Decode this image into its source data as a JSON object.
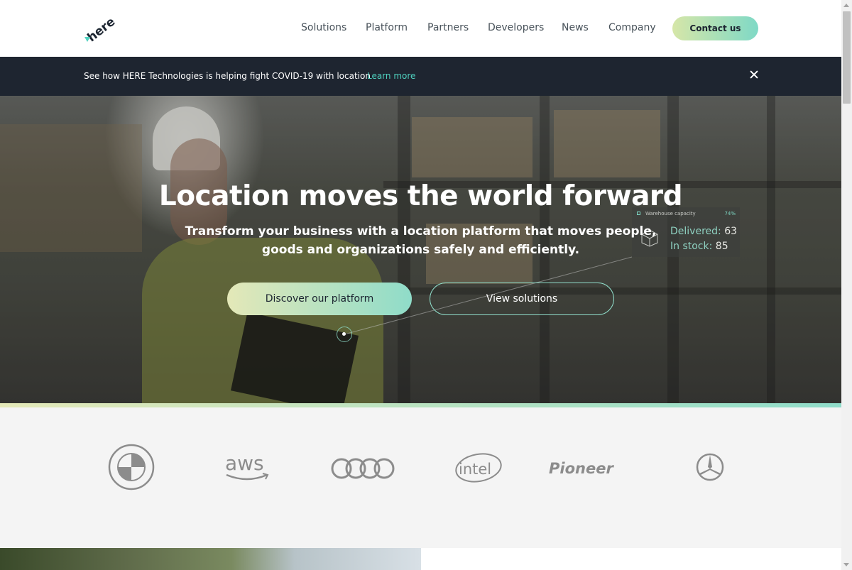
{
  "header": {
    "logo_text": "here",
    "nav": [
      "Solutions",
      "Platform",
      "Partners",
      "Developers",
      "News",
      "Company"
    ],
    "contact_label": "Contact us"
  },
  "banner": {
    "text": "See how HERE Technologies is helping fight COVID-19 with location",
    "link": "Learn more"
  },
  "hero": {
    "title": "Location moves the world forward",
    "subtitle": "Transform your business with a location platform that moves people, goods and organizations safely and efficiently.",
    "primary_cta": "Discover our platform",
    "secondary_cta": "View solutions",
    "widget": {
      "heading": "Warehouse capacity",
      "percent": "74%",
      "delivered_label": "Delivered:",
      "delivered_value": "63",
      "stock_label": "In stock:",
      "stock_value": "85"
    }
  },
  "partners": {
    "logos": [
      "BMW",
      "aws",
      "Audi",
      "intel",
      "Pioneer",
      "Mercedes-Benz"
    ],
    "aws_text": "aws",
    "intel_text": "intel",
    "pioneer_text": "Pioneer"
  },
  "colors": {
    "accent_start": "#e4e8b8",
    "accent_end": "#8fdcc9",
    "banner_bg": "#1e2530",
    "link": "#4fd1bf"
  }
}
